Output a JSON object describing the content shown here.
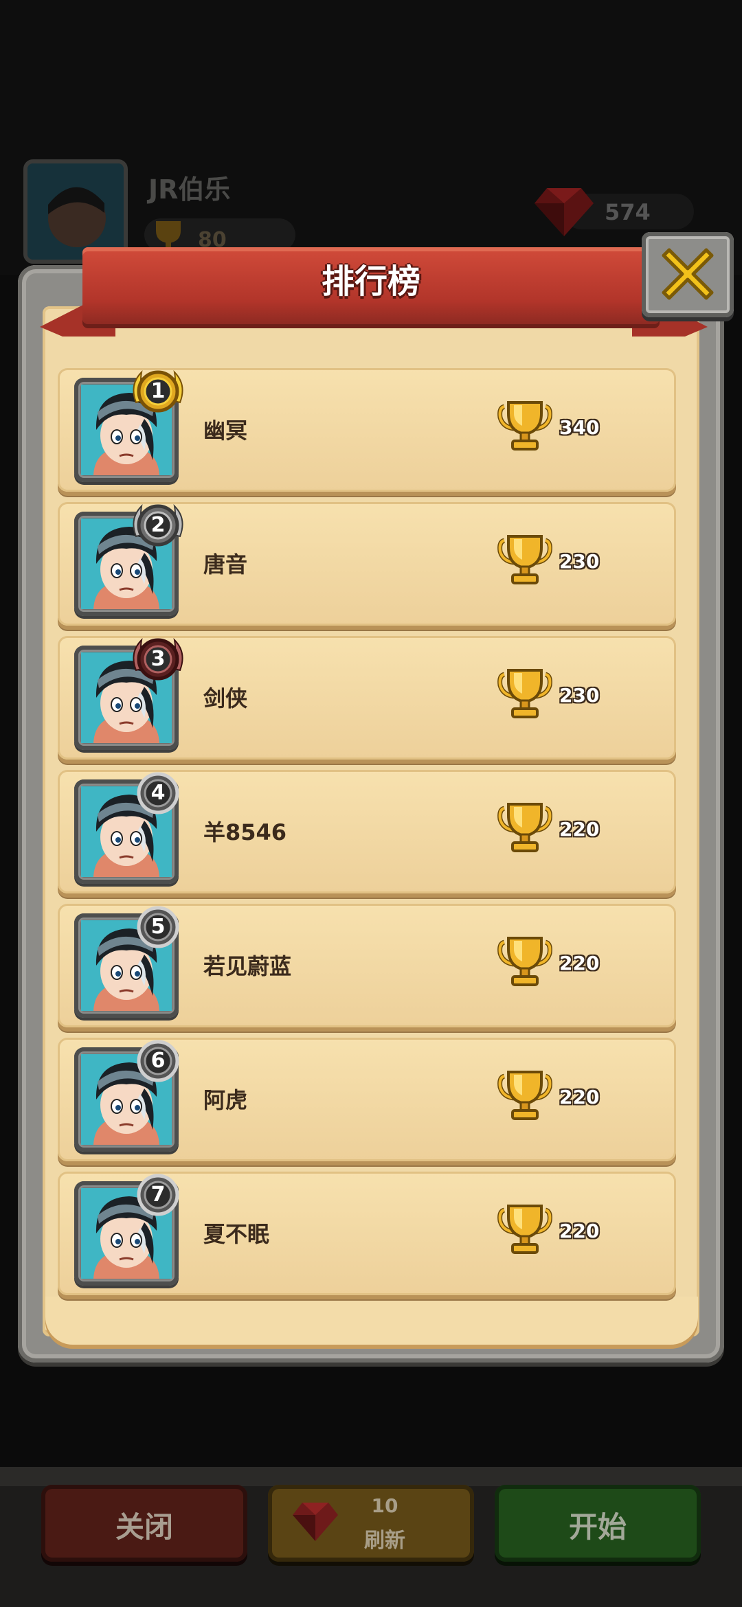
{
  "profile": {
    "name": "JR伯乐",
    "trophies": "80",
    "gems": "574"
  },
  "dialog": {
    "title": "排行榜"
  },
  "leaderboard": [
    {
      "rank": "1",
      "name": "幽冥",
      "score": "340",
      "badge": "gold-laurel"
    },
    {
      "rank": "2",
      "name": "唐音",
      "score": "230",
      "badge": "silver-laurel"
    },
    {
      "rank": "3",
      "name": "剑侠",
      "score": "230",
      "badge": "bronze-laurel"
    },
    {
      "rank": "4",
      "name": "羊8546",
      "score": "220",
      "badge": "plain"
    },
    {
      "rank": "5",
      "name": "若见蔚蓝",
      "score": "220",
      "badge": "plain"
    },
    {
      "rank": "6",
      "name": "阿虎",
      "score": "220",
      "badge": "plain"
    },
    {
      "rank": "7",
      "name": "夏不眠",
      "score": "220",
      "badge": "plain"
    }
  ],
  "buttons": {
    "close": "关闭",
    "refresh_cost": "10",
    "refresh": "刷新",
    "start": "开始"
  },
  "icons": {
    "close": "close-x-icon",
    "trophy": "trophy-icon",
    "gem": "ruby-gem-icon"
  },
  "colors": {
    "banner": "#b2352a",
    "parchment": "#f0d9a7",
    "gold_badge": "#e0a820",
    "silver_badge": "#8c8c8c",
    "bronze_badge": "#8a3b3b",
    "close_button": "#f2c21b"
  }
}
